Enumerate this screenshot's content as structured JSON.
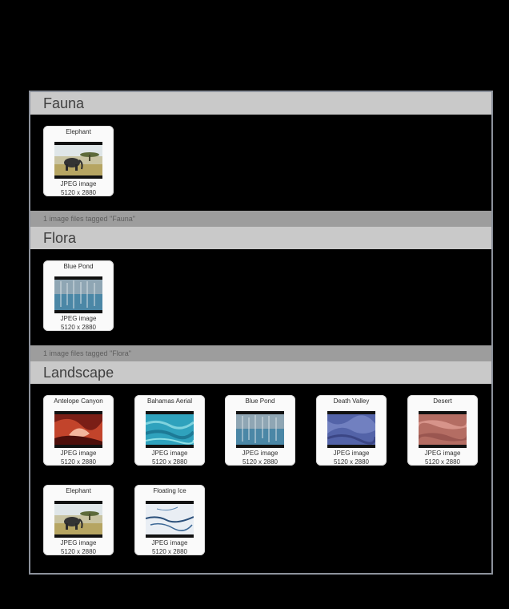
{
  "sections": [
    {
      "title": "Fauna",
      "footer": "1 image files tagged \"Fauna\"",
      "items": [
        {
          "title": "Elephant",
          "kind": "JPEG image",
          "dims": "5120 x 2880",
          "thumb": "elephant"
        }
      ]
    },
    {
      "title": "Flora",
      "footer": "1 image files tagged \"Flora\"",
      "items": [
        {
          "title": "Blue Pond",
          "kind": "JPEG image",
          "dims": "5120 x 2880",
          "thumb": "bluepond"
        }
      ]
    },
    {
      "title": "Landscape",
      "items": [
        {
          "title": "Antelope Canyon",
          "kind": "JPEG image",
          "dims": "5120 x 2880",
          "thumb": "antelope"
        },
        {
          "title": "Bahamas Aerial",
          "kind": "JPEG image",
          "dims": "5120 x 2880",
          "thumb": "bahamas"
        },
        {
          "title": "Blue Pond",
          "kind": "JPEG image",
          "dims": "5120 x 2880",
          "thumb": "bluepond"
        },
        {
          "title": "Death Valley",
          "kind": "JPEG image",
          "dims": "5120 x 2880",
          "thumb": "deathvalley"
        },
        {
          "title": "Desert",
          "kind": "JPEG image",
          "dims": "5120 x 2880",
          "thumb": "desert"
        },
        {
          "title": "Elephant",
          "kind": "JPEG image",
          "dims": "5120 x 2880",
          "thumb": "elephant"
        },
        {
          "title": "Floating Ice",
          "kind": "JPEG image",
          "dims": "5120 x 2880",
          "thumb": "ice"
        }
      ]
    }
  ]
}
